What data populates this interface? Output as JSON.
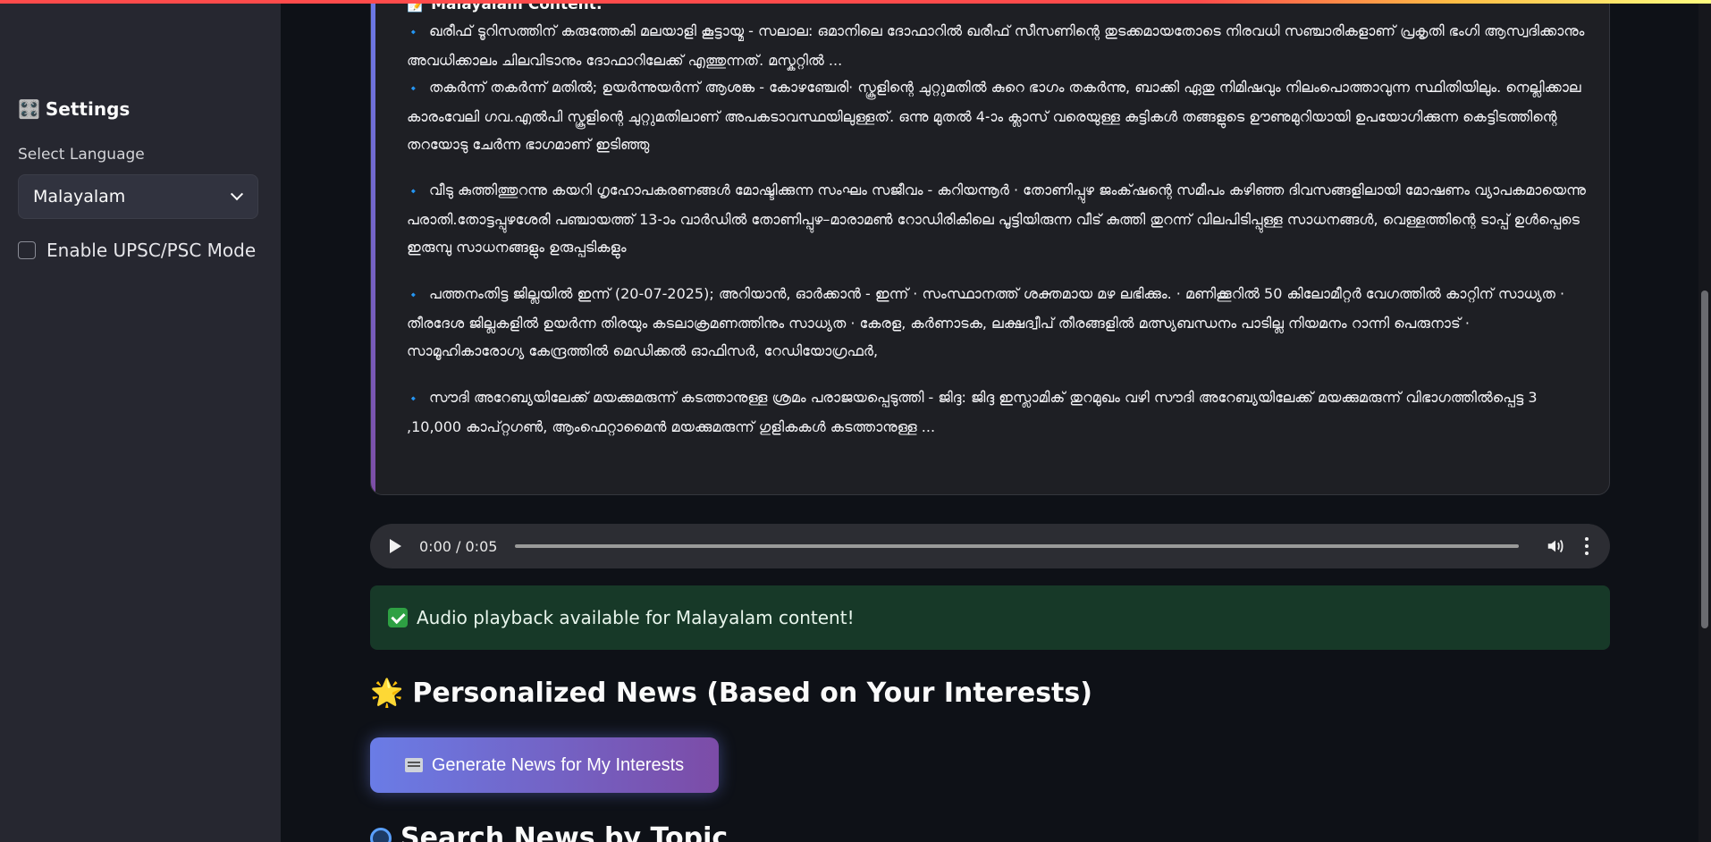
{
  "sidebar": {
    "settings_icon": "🎛️",
    "settings_title": "Settings",
    "language_label": "Select Language",
    "language_value": "Malayalam",
    "upsc_label": "Enable UPSC/PSC Mode",
    "upsc_checked": false
  },
  "content": {
    "heading": "📝 Malayalam Content:",
    "bullet_icon": "🔹",
    "items": [
      "ഖരീഫ് ടൂറിസത്തിന് കരുത്തേകി മലയാളി കൂട്ടായ്മ - സലാല: ഒമാനിലെ ദോഫാറിൽ ഖരീഫ് സീസണിന്റെ തുടക്കമായതോടെ നിരവധി സഞ്ചാരികളാണ് പ്രകൃതി ഭംഗി ആസ്വദിക്കാനും അവധിക്കാലം ചിലവിടാനും ദോഫാറിലേക്ക് എത്തുന്നത്. മസ്കറ്റിൽ ...",
      "തകർന്ന് തകർന്ന് മതിൽ; ഉയർന്നുയർന്ന് ആശങ്ക - കോഴഞ്ചേരി· സ്കൂളിന്റെ ചുറ്റുമതിൽ കുറെ ഭാഗം തകർന്നു, ബാക്കി ഏതു നിമിഷവും നിലംപൊത്താവുന്ന സ്ഥിതിയിലും. നെല്ലിക്കാല കാരംവേലി ഗവ.എൽപി സ്കൂളിന്റെ ചുറ്റുമതിലാണ് അപകടാവസ്ഥയിലുള്ളത്. ഒന്നു മുതൽ 4-ാം ക്ലാസ് വരെയുള്ള കുട്ടികൾ തങ്ങളുടെ ഊണുമുറിയായി ഉപയോഗിക്കുന്ന കെട്ടിടത്തിന്റെ തറയോടു ചേർന്ന ഭാഗമാണ് ഇടിഞ്ഞു",
      "വീടു കുത്തിത്തുറന്നു കയറി ഗൃഹോപകരണങ്ങൾ മോഷ്ടിക്കുന്ന സംഘം സജീവം - കറിയന്നൂർ · തോണിപ്പുഴ ജംക്‌ഷന്റെ സമീപം കഴിഞ്ഞ ദിവസങ്ങളിലായി മോഷണം വ്യാപകമായെന്നു പരാതി.തോട്ടപ്പുഴശേരി പഞ്ചായത്ത് 13-ാം വാർഡിൽ തോണിപ്പുഴ–മാരാമൺ റോഡിരികിലെ പൂട്ടിയിരുന്ന വീട് കുത്തി തുറന്ന് വിലപിടിപ്പുള്ള സാധനങ്ങൾ, വെള്ളത്തിന്റെ ടാപ്പ് ഉൾപ്പെടെ ഇരുമ്പു സാധനങ്ങളും ഉരുപ്പടികളും",
      "പത്തനംതിട്ട ജില്ലയിൽ ഇന്ന് (20-07-2025); അറിയാൻ, ഓർക്കാൻ - ഇന്ന് · സംസ്ഥാനത്ത് ശക്തമായ മഴ ലഭിക്കും. · മണിക്കൂറിൽ 50 കിലോമീറ്റർ വേഗത്തിൽ കാറ്റിന് സാധ്യത · തീരദേശ ജില്ലകളിൽ ഉയർന്ന തിരയും കടലാക്രമണത്തിനും സാധ്യത · കേരള, കർണാടക, ലക്ഷദ്വീപ് തീരങ്ങളിൽ മത്സ്യബന്ധനം പാടില്ല നിയമനം റാന്നി പെരുനാട് · സാമൂഹികാരോഗ്യ കേന്ദ്രത്തിൽ മെഡിക്കൽ ഓഫിസർ, റേഡിയോഗ്രഫർ,",
      "സൗദി അറേബ്യയിലേക്ക് മയക്കുമരുന്ന് കടത്താനുള്ള ശ്രമം പരാജയപ്പെടുത്തി - ജിദ്ദ: ജിദ്ദ ഇസ്ലാമിക് തുറമുഖം വഴി സൗദി അറേബ്യയിലേക്ക് മയക്കുമരുന്ന് വിഭാഗത്തിൽപ്പെട്ട 3 ,10,000 കാപ്റ്റഗൺ, ആംഫെറ്റാമൈൻ മയക്കുമരുന്ന് ഗുളികകൾ കടത്താനുള്ള ..."
    ]
  },
  "audio": {
    "time": "0:00 / 0:05",
    "progress": 0
  },
  "status": {
    "message": "Audio playback available for Malayalam content!"
  },
  "personalized": {
    "icon": "🌟",
    "title": "Personalized News (Based on Your Interests)",
    "button_label": "Generate News for My Interests"
  },
  "search": {
    "title": "Search News by Topic"
  },
  "colors": {
    "accent_gradient_start": "#6a7ce6",
    "accent_gradient_end": "#7c4ca7",
    "success_bg": "#173928"
  }
}
